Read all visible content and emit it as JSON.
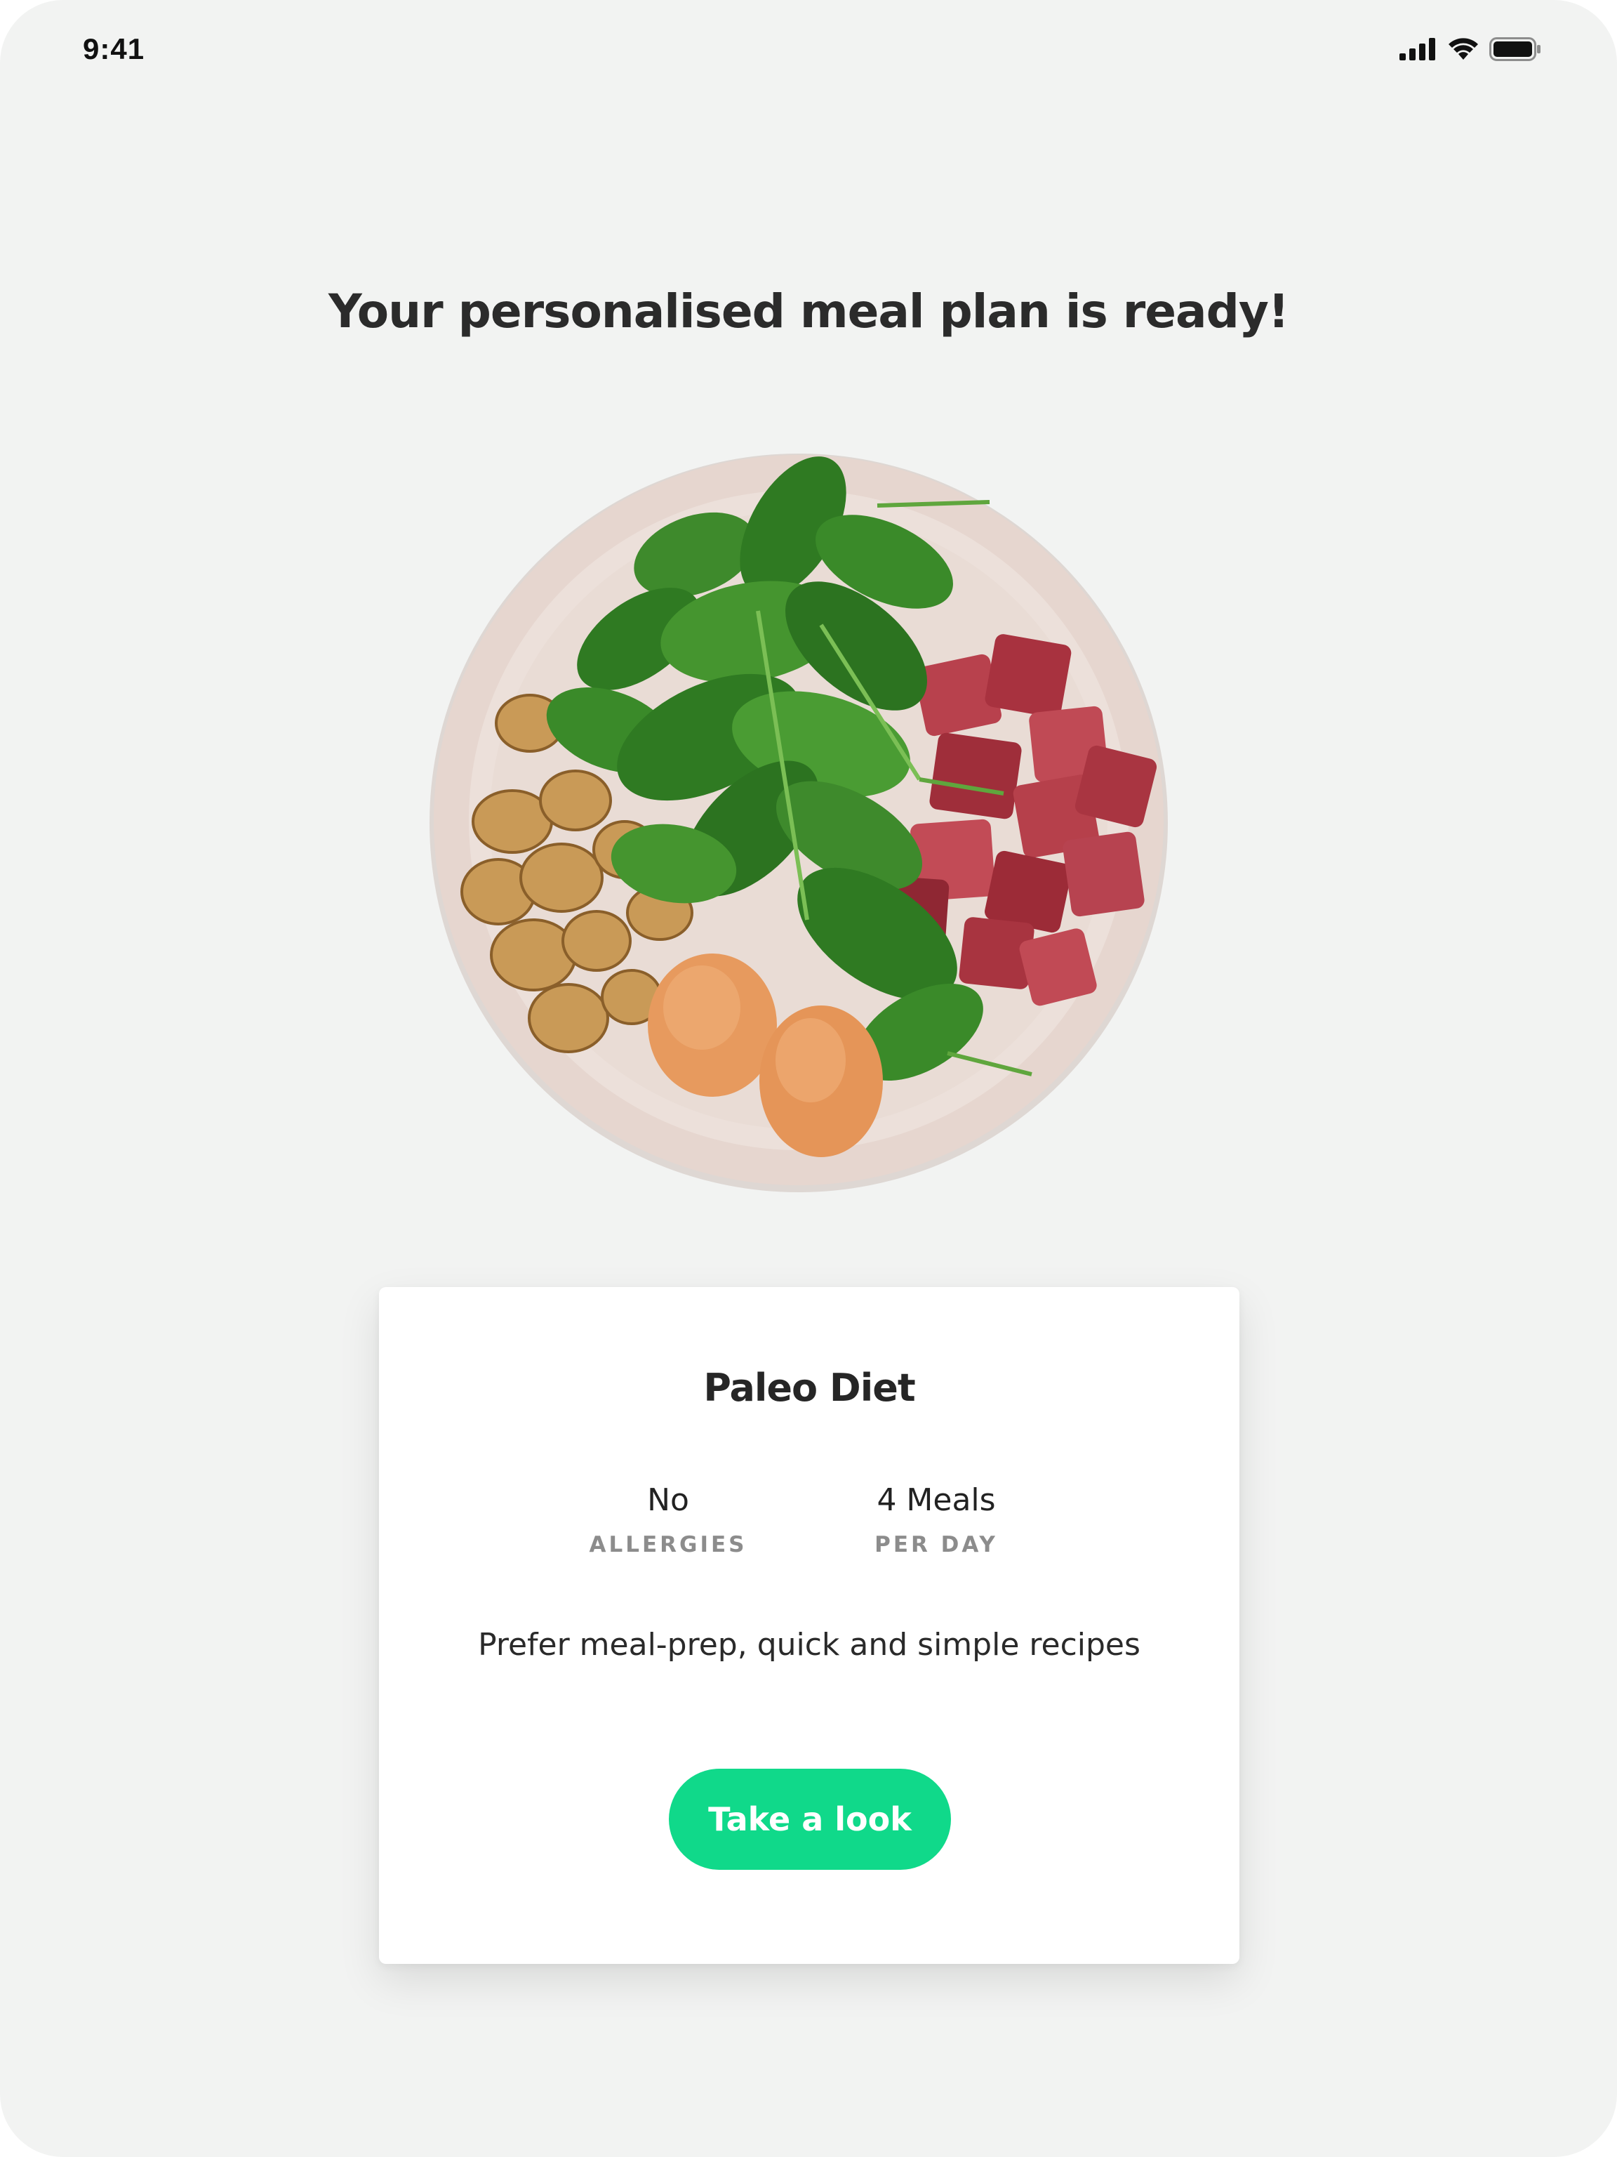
{
  "status_bar": {
    "time": "9:41",
    "icons": [
      "signal-bars-icon",
      "wifi-icon",
      "battery-icon"
    ]
  },
  "header": {
    "title": "Your personalised meal plan is ready!"
  },
  "hero_image": {
    "description_icon": "meal-plate-image"
  },
  "plan_card": {
    "name": "Paleo Diet",
    "stats": [
      {
        "value": "No",
        "label": "ALLERGIES"
      },
      {
        "value": "4 Meals",
        "label": "PER DAY"
      }
    ],
    "preferences": "Prefer meal-prep, quick and simple recipes",
    "cta_label": "Take a look"
  },
  "colors": {
    "background": "#f2f3f2",
    "accent": "#10d98a",
    "card": "#ffffff",
    "muted_label": "#8c8c8c"
  }
}
